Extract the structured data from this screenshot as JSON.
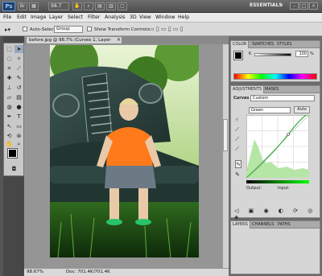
{
  "title_bar": {
    "app_logo": "Ps",
    "zoom_value": "98.7",
    "workspace": "ESSENTIALS"
  },
  "menu": [
    "File",
    "Edit",
    "Image",
    "Layer",
    "Select",
    "Filter",
    "Analysis",
    "3D",
    "View",
    "Window",
    "Help"
  ],
  "options_bar": {
    "auto_select_label": "Auto-Select:",
    "auto_select_value": "Group",
    "transform_label": "Show Transform Controls"
  },
  "document": {
    "tab_label": "before.jpg @ 98.7% (Curves 1, Layer Mask/8) *",
    "status_zoom": "98.67%",
    "status_doc": "Doc: 701.4K/701.4K"
  },
  "color_panel": {
    "tabs": [
      "COLOR",
      "SWATCHES",
      "STYLES"
    ],
    "slider_label": "K",
    "slider_value": "100",
    "slider_unit": "%"
  },
  "adjustments_panel": {
    "tabs": [
      "ADJUSTMENTS",
      "MASKS"
    ],
    "type_label": "Curves",
    "preset_value": "Custom",
    "channel_value": "Green",
    "auto_label": "Auto",
    "output_label": "Output:",
    "input_label": "Input:"
  },
  "layers_panel": {
    "tabs": [
      "LAYERS",
      "CHANNELS",
      "PATHS"
    ]
  },
  "colors": {
    "accent": "#1c3f6e",
    "curve": "#3fb03f"
  }
}
